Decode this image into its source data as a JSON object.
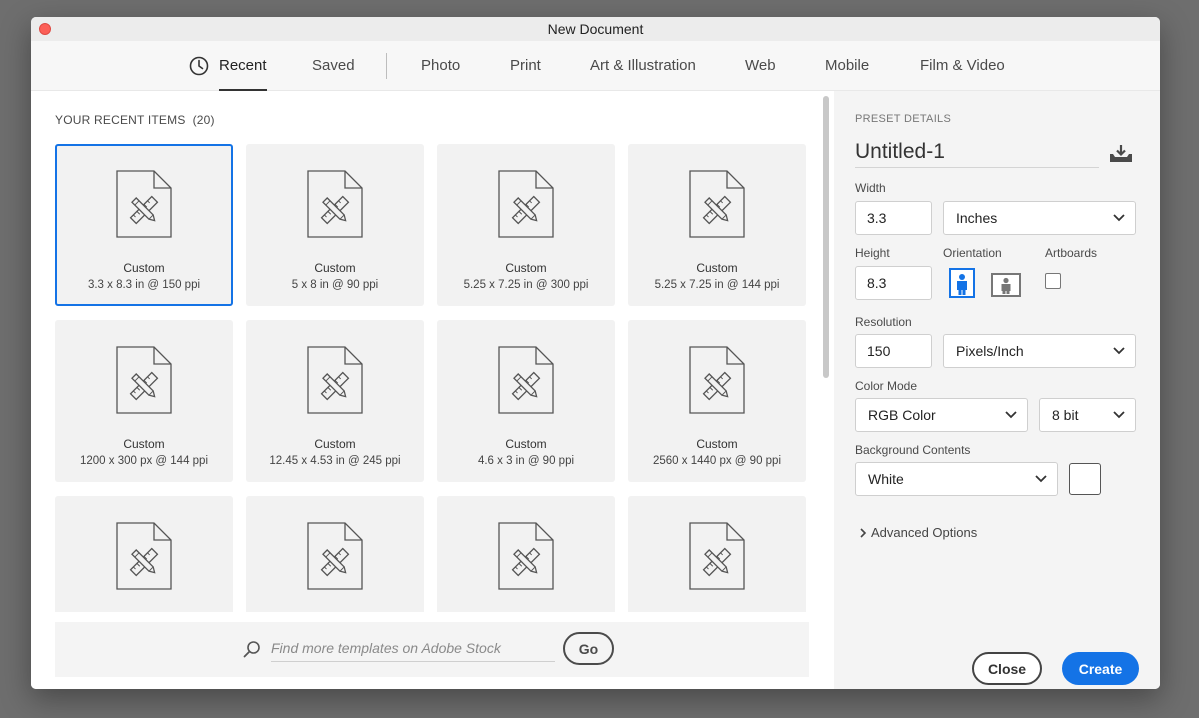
{
  "window": {
    "title": "New Document"
  },
  "tabs": [
    {
      "label": "Recent",
      "active": true
    },
    {
      "label": "Saved"
    },
    {
      "label": "Photo"
    },
    {
      "label": "Print"
    },
    {
      "label": "Art & Illustration"
    },
    {
      "label": "Web"
    },
    {
      "label": "Mobile"
    },
    {
      "label": "Film & Video"
    }
  ],
  "recent": {
    "title": "YOUR RECENT ITEMS",
    "count": "(20)",
    "items": [
      {
        "name": "Custom",
        "dims": "3.3 x 8.3 in @ 150 ppi",
        "selected": true
      },
      {
        "name": "Custom",
        "dims": "5 x 8 in @ 90 ppi"
      },
      {
        "name": "Custom",
        "dims": "5.25 x 7.25 in @ 300 ppi"
      },
      {
        "name": "Custom",
        "dims": "5.25 x 7.25 in @ 144 ppi"
      },
      {
        "name": "Custom",
        "dims": "1200 x 300 px @ 144 ppi"
      },
      {
        "name": "Custom",
        "dims": "12.45 x 4.53 in @ 245 ppi"
      },
      {
        "name": "Custom",
        "dims": "4.6 x 3 in @ 90 ppi"
      },
      {
        "name": "Custom",
        "dims": "2560 x 1440 px @ 90 ppi"
      },
      {
        "name": "",
        "dims": ""
      },
      {
        "name": "",
        "dims": ""
      },
      {
        "name": "",
        "dims": ""
      },
      {
        "name": "",
        "dims": ""
      }
    ]
  },
  "stock": {
    "placeholder": "Find more templates on Adobe Stock",
    "go_label": "Go"
  },
  "preset": {
    "section_title": "PRESET DETAILS",
    "doc_name": "Untitled-1",
    "width_label": "Width",
    "width_value": "3.3",
    "units": "Inches",
    "height_label": "Height",
    "height_value": "8.3",
    "orientation_label": "Orientation",
    "artboards_label": "Artboards",
    "resolution_label": "Resolution",
    "resolution_value": "150",
    "resolution_units": "Pixels/Inch",
    "color_mode_label": "Color Mode",
    "color_mode": "RGB Color",
    "bit_depth": "8 bit",
    "background_label": "Background Contents",
    "background": "White",
    "advanced_label": "Advanced Options"
  },
  "buttons": {
    "close": "Close",
    "create": "Create"
  },
  "colors": {
    "accent": "#1473e6",
    "panel": "#f4f4f4",
    "card": "#f2f2f2"
  }
}
